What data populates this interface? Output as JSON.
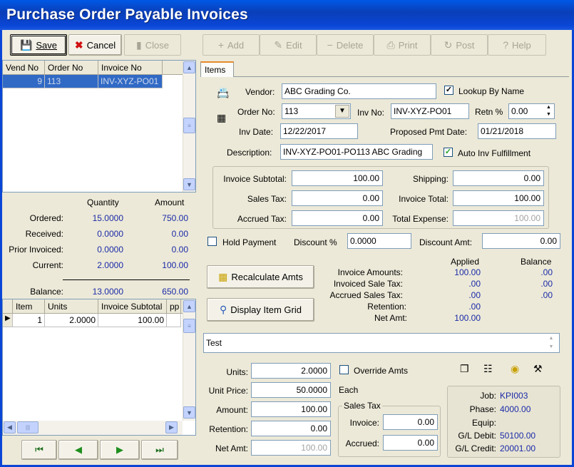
{
  "window": {
    "title": "Purchase Order Payable Invoices"
  },
  "toolbar": {
    "save": "Save",
    "cancel": "Cancel",
    "close": "Close",
    "add": "Add",
    "edit": "Edit",
    "delete": "Delete",
    "print": "Print",
    "post": "Post",
    "help": "Help"
  },
  "vendor_grid": {
    "headers": [
      "Vend No",
      "Order No",
      "Invoice No"
    ],
    "rows": [
      [
        "9",
        "113",
        "INV-XYZ-PO01"
      ]
    ]
  },
  "summary": {
    "col_quantity": "Quantity",
    "col_amount": "Amount",
    "rows": [
      {
        "label": "Ordered:",
        "qty": "15.0000",
        "amt": "750.00"
      },
      {
        "label": "Received:",
        "qty": "0.0000",
        "amt": "0.00"
      },
      {
        "label": "Prior Invoiced:",
        "qty": "0.0000",
        "amt": "0.00"
      },
      {
        "label": "Current:",
        "qty": "2.0000",
        "amt": "100.00"
      }
    ],
    "balance_label": "Balance:",
    "balance_qty": "13.0000",
    "balance_amt": "650.00"
  },
  "item_grid": {
    "headers": [
      "Item",
      "Units",
      "Invoice Subtotal",
      "pp"
    ],
    "rows": [
      [
        "1",
        "2.0000",
        "100.00",
        ""
      ]
    ]
  },
  "tabs": {
    "items": "Items"
  },
  "form": {
    "vendor_label": "Vendor:",
    "vendor": "ABC Grading Co.",
    "lookup_label": "Lookup By Name",
    "order_no_label": "Order No:",
    "order_no": "113",
    "inv_no_label": "Inv No:",
    "inv_no": "INV-XYZ-PO01",
    "retn_label": "Retn %",
    "retn": "0.00",
    "inv_date_label": "Inv Date:",
    "inv_date": "12/22/2017",
    "pmt_date_label": "Proposed Pmt Date:",
    "pmt_date": "01/21/2018",
    "desc_label": "Description:",
    "desc": "INV-XYZ-PO01-PO113 ABC Grading",
    "auto_label": "Auto Inv Fulfillment"
  },
  "totals": {
    "subtotal_label": "Invoice Subtotal:",
    "subtotal": "100.00",
    "shipping_label": "Shipping:",
    "shipping": "0.00",
    "tax_label": "Sales Tax:",
    "tax": "0.00",
    "total_label": "Invoice Total:",
    "total": "100.00",
    "accrued_label": "Accrued Tax:",
    "accrued": "0.00",
    "expense_label": "Total Expense:",
    "expense": "100.00"
  },
  "hold": {
    "hold_label": "Hold Payment",
    "disc_pct_label": "Discount %",
    "disc_pct": "0.0000",
    "disc_amt_label": "Discount Amt:",
    "disc_amt": "0.00"
  },
  "actions": {
    "recalc": "Recalculate Amts",
    "display": "Display Item Grid"
  },
  "applied": {
    "col_applied": "Applied",
    "col_balance": "Balance",
    "rows": [
      {
        "label": "Invoice Amounts:",
        "applied": "100.00",
        "balance": ".00"
      },
      {
        "label": "Invoiced Sale Tax:",
        "applied": ".00",
        "balance": ".00"
      },
      {
        "label": "Accrued Sales Tax:",
        "applied": ".00",
        "balance": ".00"
      },
      {
        "label": "Retention:",
        "applied": ".00",
        "balance": ""
      },
      {
        "label": "Net Amt:",
        "applied": "100.00",
        "balance": ""
      }
    ]
  },
  "memo": "Test",
  "line": {
    "units_label": "Units:",
    "units": "2.0000",
    "override_label": "Override Amts",
    "price_label": "Unit Price:",
    "price": "50.0000",
    "each": "Each",
    "amount_label": "Amount:",
    "amount": "100.00",
    "retention_label": "Retention:",
    "retention": "0.00",
    "net_label": "Net Amt:",
    "net": "100.00",
    "sales_tax_group": "Sales Tax",
    "invoice_label": "Invoice:",
    "invoice_tax": "0.00",
    "accrued_label": "Accrued:",
    "accrued_tax": "0.00"
  },
  "job": {
    "job_label": "Job:",
    "job": "KPI003",
    "phase_label": "Phase:",
    "phase": "4000.00",
    "equip_label": "Equip:",
    "equip": "",
    "gl_debit_label": "G/L Debit:",
    "gl_debit": "50100.00",
    "gl_credit_label": "G/L Credit:",
    "gl_credit": "20001.00"
  }
}
